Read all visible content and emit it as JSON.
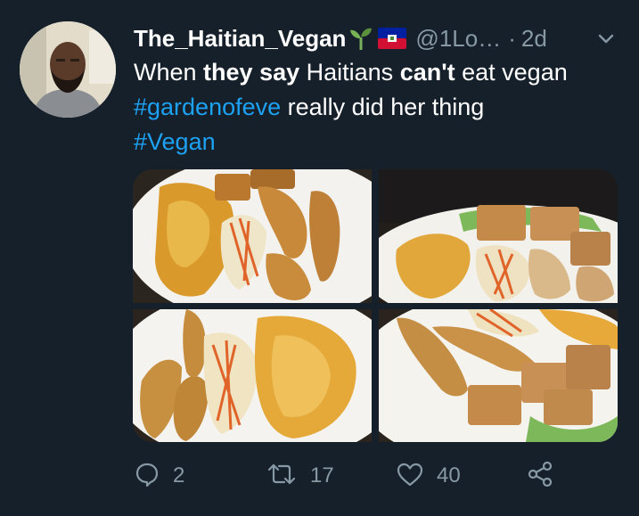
{
  "tweet": {
    "display_name": "The_Haitian_Vegan",
    "handle": "@1Lo…",
    "separator": "·",
    "time": "2d",
    "text": {
      "w1": "When ",
      "w2": "they say",
      "w3": " Haitians ",
      "w4": "can't",
      "w5": " eat vegan",
      "hashtag1": "#gardenofeve",
      "w6": " really did her thing",
      "hashtag2": "#Vegan"
    },
    "actions": {
      "reply_count": "2",
      "retweet_count": "17",
      "like_count": "40"
    }
  },
  "colors": {
    "background": "#15202b",
    "secondary_text": "#8899a6",
    "link": "#1da1f2"
  },
  "icons": {
    "sprout": "sprout-emoji-icon",
    "flag": "haiti-flag-icon",
    "caret": "chevron-down-icon",
    "reply": "reply-icon",
    "retweet": "retweet-icon",
    "like": "heart-icon",
    "share": "share-icon"
  }
}
